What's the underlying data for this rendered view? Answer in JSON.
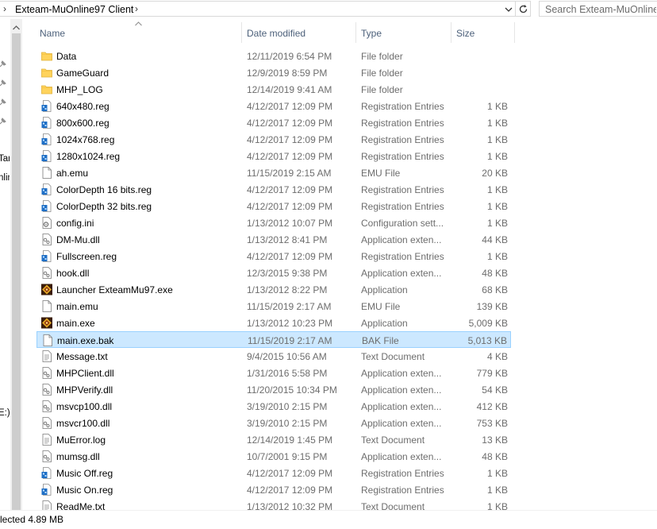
{
  "address": {
    "path_label": "Exteam-MuOnline97 Client"
  },
  "search": {
    "placeholder": "Search Exteam-MuOnline97 Client"
  },
  "nav_fragments": [
    "Tar",
    "nlin",
    "E:)"
  ],
  "columns": {
    "name": "Name",
    "date": "Date modified",
    "type": "Type",
    "size": "Size"
  },
  "files": [
    {
      "name": "Data",
      "date": "12/11/2019 6:54 PM",
      "type": "File folder",
      "size": "",
      "icon": "folder-icon"
    },
    {
      "name": "GameGuard",
      "date": "12/9/2019 8:59 PM",
      "type": "File folder",
      "size": "",
      "icon": "folder-icon"
    },
    {
      "name": "MHP_LOG",
      "date": "12/14/2019 9:41 AM",
      "type": "File folder",
      "size": "",
      "icon": "folder-icon"
    },
    {
      "name": "640x480.reg",
      "date": "4/12/2017 12:09 PM",
      "type": "Registration Entries",
      "size": "1 KB",
      "icon": "registry-file-icon"
    },
    {
      "name": "800x600.reg",
      "date": "4/12/2017 12:09 PM",
      "type": "Registration Entries",
      "size": "1 KB",
      "icon": "registry-file-icon"
    },
    {
      "name": "1024x768.reg",
      "date": "4/12/2017 12:09 PM",
      "type": "Registration Entries",
      "size": "1 KB",
      "icon": "registry-file-icon"
    },
    {
      "name": "1280x1024.reg",
      "date": "4/12/2017 12:09 PM",
      "type": "Registration Entries",
      "size": "1 KB",
      "icon": "registry-file-icon"
    },
    {
      "name": "ah.emu",
      "date": "11/15/2019 2:15 AM",
      "type": "EMU File",
      "size": "20 KB",
      "icon": "blank-file-icon"
    },
    {
      "name": "ColorDepth 16 bits.reg",
      "date": "4/12/2017 12:09 PM",
      "type": "Registration Entries",
      "size": "1 KB",
      "icon": "registry-file-icon"
    },
    {
      "name": "ColorDepth 32 bits.reg",
      "date": "4/12/2017 12:09 PM",
      "type": "Registration Entries",
      "size": "1 KB",
      "icon": "registry-file-icon"
    },
    {
      "name": "config.ini",
      "date": "1/13/2012 10:07 PM",
      "type": "Configuration sett...",
      "size": "1 KB",
      "icon": "config-file-icon"
    },
    {
      "name": "DM-Mu.dll",
      "date": "1/13/2012 8:41 PM",
      "type": "Application exten...",
      "size": "44 KB",
      "icon": "dll-file-icon"
    },
    {
      "name": "Fullscreen.reg",
      "date": "4/12/2017 12:09 PM",
      "type": "Registration Entries",
      "size": "1 KB",
      "icon": "registry-file-icon"
    },
    {
      "name": "hook.dll",
      "date": "12/3/2015 9:38 PM",
      "type": "Application exten...",
      "size": "48 KB",
      "icon": "dll-file-icon"
    },
    {
      "name": "Launcher ExteamMu97.exe",
      "date": "1/13/2012 8:22 PM",
      "type": "Application",
      "size": "68 KB",
      "icon": "game-exe-icon"
    },
    {
      "name": "main.emu",
      "date": "11/15/2019 2:17 AM",
      "type": "EMU File",
      "size": "139 KB",
      "icon": "blank-file-icon"
    },
    {
      "name": "main.exe",
      "date": "1/13/2012 10:23 PM",
      "type": "Application",
      "size": "5,009 KB",
      "icon": "game-exe-icon"
    },
    {
      "name": "main.exe.bak",
      "date": "11/15/2019 2:17 AM",
      "type": "BAK File",
      "size": "5,013 KB",
      "icon": "blank-file-icon",
      "selected": true
    },
    {
      "name": "Message.txt",
      "date": "9/4/2015 10:56 AM",
      "type": "Text Document",
      "size": "4 KB",
      "icon": "text-file-icon"
    },
    {
      "name": "MHPClient.dll",
      "date": "1/31/2016 5:58 PM",
      "type": "Application exten...",
      "size": "779 KB",
      "icon": "dll-file-icon"
    },
    {
      "name": "MHPVerify.dll",
      "date": "11/20/2015 10:34 PM",
      "type": "Application exten...",
      "size": "54 KB",
      "icon": "dll-file-icon"
    },
    {
      "name": "msvcp100.dll",
      "date": "3/19/2010 2:15 PM",
      "type": "Application exten...",
      "size": "412 KB",
      "icon": "dll-file-icon"
    },
    {
      "name": "msvcr100.dll",
      "date": "3/19/2010 2:15 PM",
      "type": "Application exten...",
      "size": "753 KB",
      "icon": "dll-file-icon"
    },
    {
      "name": "MuError.log",
      "date": "12/14/2019 1:45 PM",
      "type": "Text Document",
      "size": "13 KB",
      "icon": "text-file-icon"
    },
    {
      "name": "mumsg.dll",
      "date": "10/7/2001 9:15 PM",
      "type": "Application exten...",
      "size": "48 KB",
      "icon": "dll-file-icon"
    },
    {
      "name": "Music Off.reg",
      "date": "4/12/2017 12:09 PM",
      "type": "Registration Entries",
      "size": "1 KB",
      "icon": "registry-file-icon"
    },
    {
      "name": "Music On.reg",
      "date": "4/12/2017 12:09 PM",
      "type": "Registration Entries",
      "size": "1 KB",
      "icon": "registry-file-icon"
    },
    {
      "name": "ReadMe.txt",
      "date": "1/13/2012 10:32 PM",
      "type": "Text Document",
      "size": "1 KB",
      "icon": "text-file-icon"
    }
  ],
  "status": {
    "text": "lected  4.89 MB"
  },
  "colors": {
    "selection_bg": "#cce8ff",
    "selection_border": "#99d1ff",
    "header_text": "#4c607a",
    "folder": "#ffd35c"
  }
}
